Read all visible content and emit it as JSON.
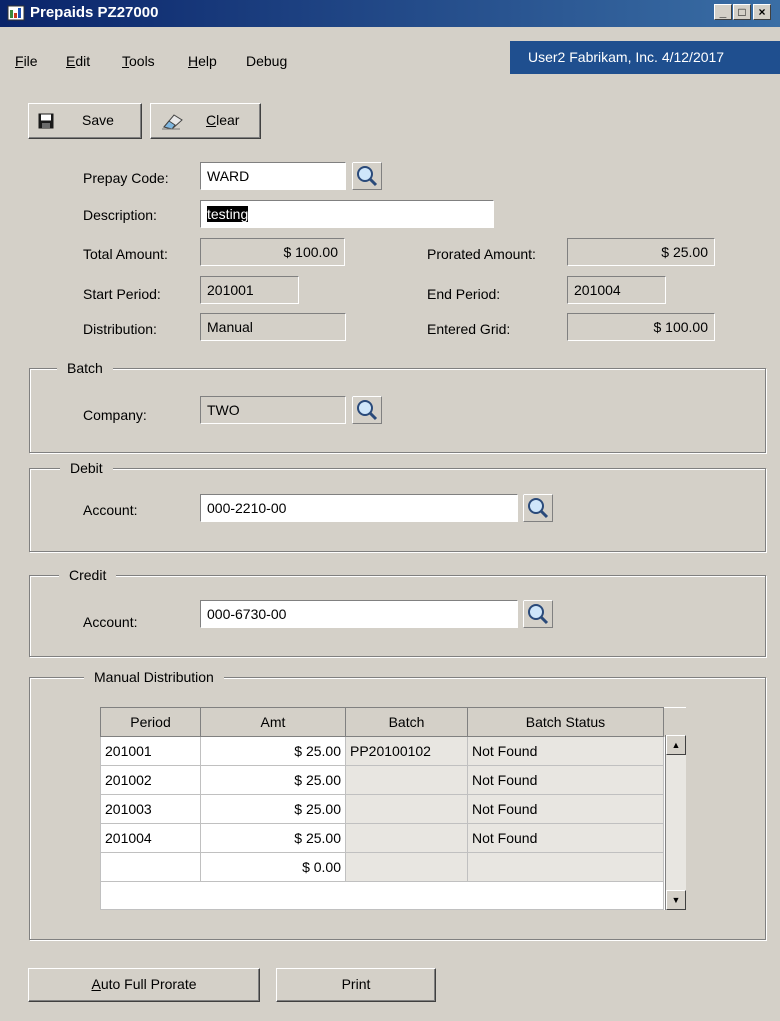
{
  "window": {
    "title": "Prepaids PZ27000",
    "controls": [
      "minimize-icon",
      "maximize-icon",
      "close-icon"
    ]
  },
  "menu": {
    "items": [
      "File",
      "Edit",
      "Tools",
      "Help",
      "Debug"
    ]
  },
  "user_info": "User2  Fabrikam, Inc.  4/12/2017",
  "toolbar": {
    "save_label": "Save",
    "clear_label": "Clear"
  },
  "form": {
    "prepay_code_label": "Prepay Code:",
    "prepay_code": "WARD",
    "description_label": "Description:",
    "description": "testing",
    "total_amount_label": "Total Amount:",
    "total_amount": "$ 100.00",
    "prorated_amount_label": "Prorated Amount:",
    "prorated_amount": "$ 25.00",
    "start_period_label": "Start Period:",
    "start_period": "201001",
    "end_period_label": "End Period:",
    "end_period": "201004",
    "distribution_label": "Distribution:",
    "distribution": "Manual",
    "entered_grid_label": "Entered Grid:",
    "entered_grid": "$ 100.00"
  },
  "batch": {
    "title": "Batch",
    "company_label": "Company:",
    "company": "TWO"
  },
  "debit": {
    "title": "Debit",
    "account_label": "Account:",
    "account": "000-2210-00"
  },
  "credit": {
    "title": "Credit",
    "account_label": "Account:",
    "account": "000-6730-00"
  },
  "manual_distribution": {
    "title": "Manual Distribution",
    "columns": [
      "Period",
      "Amt",
      "Batch",
      "Batch Status"
    ],
    "rows": [
      [
        "201001",
        "$ 25.00",
        "PP20100102",
        "Not Found"
      ],
      [
        "201002",
        "$ 25.00",
        "",
        "Not Found"
      ],
      [
        "201003",
        "$ 25.00",
        "",
        "Not Found"
      ],
      [
        "201004",
        "$ 25.00",
        "",
        "Not Found"
      ],
      [
        "",
        "$ 0.00",
        "",
        ""
      ]
    ]
  },
  "footer": {
    "auto_full_prorate_label": "Auto Full Prorate",
    "print_label": "Print"
  }
}
